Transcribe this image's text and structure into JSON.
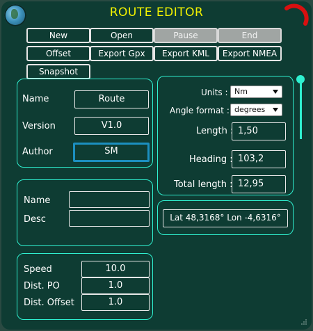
{
  "title": "ROUTE EDITOR",
  "colors": {
    "accent": "#2ff0d0",
    "title": "#f2f200",
    "focus": "#1c8fc0",
    "close": "#d81010"
  },
  "toolbar": {
    "new": "New",
    "open": "Open",
    "pause": "Pause",
    "end": "End",
    "offset": "Offset",
    "export_gpx": "Export Gpx",
    "export_kml": "Export KML",
    "export_nmea": "Export NMEA",
    "snapshot": "Snapshot"
  },
  "route": {
    "name_label": "Name",
    "name_value": "Route",
    "version_label": "Version",
    "version_value": "V1.0",
    "author_label": "Author",
    "author_value": "SM"
  },
  "waypoint": {
    "name_label": "Name",
    "name_value": "",
    "desc_label": "Desc",
    "desc_value": ""
  },
  "params": {
    "speed_label": "Speed",
    "speed_value": "10.0",
    "dist_po_label": "Dist. PO",
    "dist_po_value": "1.0",
    "dist_offset_label": "Dist. Offset",
    "dist_offset_value": "1.0"
  },
  "settings": {
    "units_label": "Units :",
    "units_value": "Nm",
    "angle_label": "Angle format :",
    "angle_value": "degrees",
    "length_label": "Length :",
    "length_value": "1,50",
    "heading_label": "Heading :",
    "heading_value": "103,2",
    "total_label": "Total length :",
    "total_value": "12,95"
  },
  "position": {
    "text": "Lat 48,3168°  Lon -4,6316°"
  }
}
